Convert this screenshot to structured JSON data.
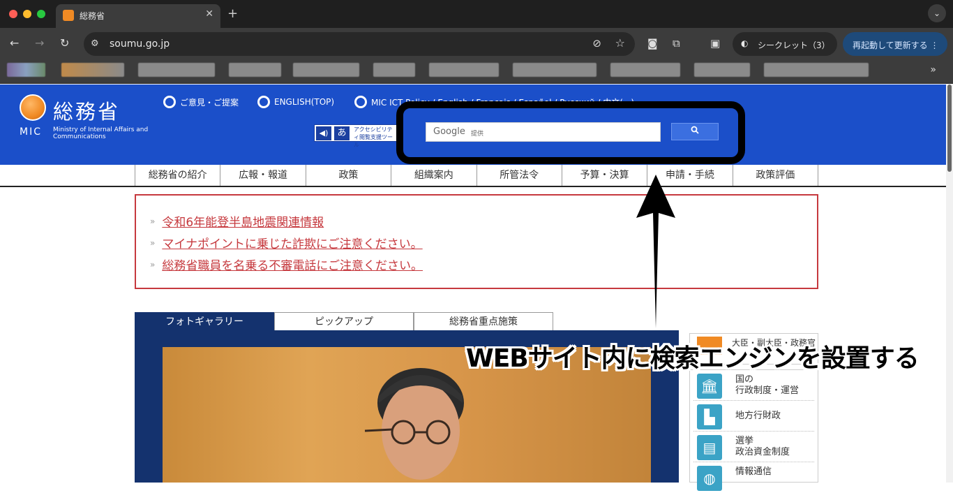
{
  "browser": {
    "tab_title": "総務省",
    "url": "soumu.go.jp",
    "incognito_label": "シークレット（3）",
    "relaunch_label": "再起動して更新する ⋮"
  },
  "site": {
    "logo_jp": "総務省",
    "logo_mic": "MIC",
    "logo_en": "Ministry of Internal Affairs and Communications",
    "header_links": [
      "ご意見・ご提案",
      "ENGLISH(TOP)",
      "MIC ICT Policy / English / Français / Español / Русский / 中文(...)"
    ],
    "accessibility_text": "アクセシビリティ閲覧支援ツール",
    "accessibility_a": "あ",
    "search": {
      "google": "Google",
      "provided": "提供",
      "button_icon": "search-icon"
    },
    "global_nav": [
      "総務省の紹介",
      "広報・報道",
      "政策",
      "組織案内",
      "所管法令",
      "予算・決算",
      "申請・手続",
      "政策評価"
    ],
    "alerts": [
      "令和6年能登半島地震関連情報",
      "マイナポイントに乗じた詐欺にご注意ください。",
      "総務省職員を名乗る不審電話にご注意ください。"
    ],
    "content_tabs": [
      "フォトギャラリー",
      "ピックアップ",
      "総務省重点施策"
    ],
    "side_top_label": "大臣・副大臣・政務官",
    "side_items": [
      {
        "label": "国の\n行政制度・運営",
        "icon": "building-icon"
      },
      {
        "label": "地方行財政",
        "icon": "city-icon"
      },
      {
        "label": "選挙\n政治資金制度",
        "icon": "ballot-box-icon"
      },
      {
        "label": "情報通信",
        "icon": "globe-icon"
      }
    ]
  },
  "annotation": {
    "caption": "WEBサイト内に検索エンジンを設置する"
  },
  "colors": {
    "header_blue": "#1b4fc9",
    "alert_red": "#c6393e",
    "gallery_navy": "#14326e",
    "logo_orange": "#f08a24"
  }
}
